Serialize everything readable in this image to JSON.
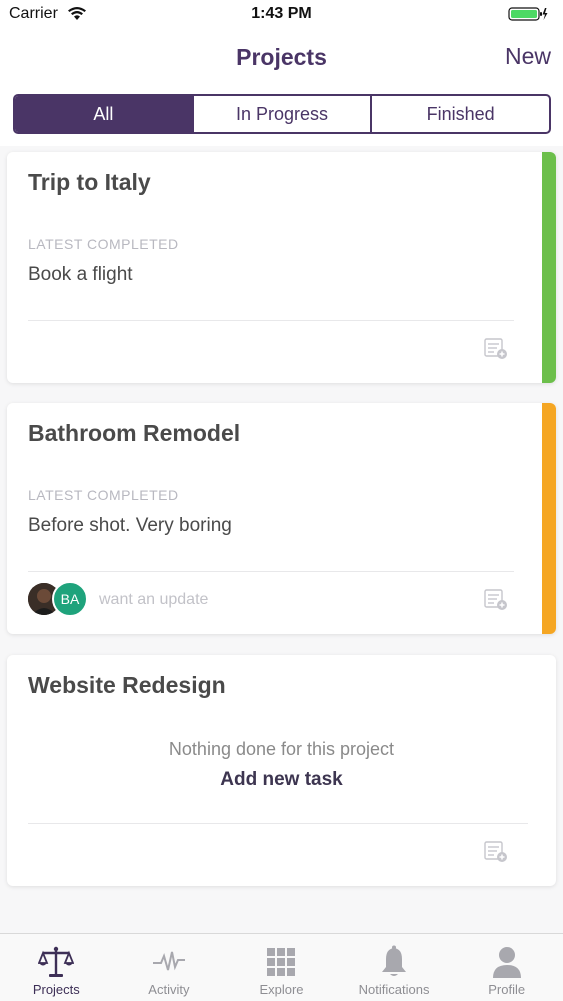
{
  "status_bar": {
    "carrier": "Carrier",
    "time": "1:43 PM"
  },
  "nav": {
    "title": "Projects",
    "new_label": "New"
  },
  "segments": [
    {
      "label": "All",
      "active": true
    },
    {
      "label": "In Progress",
      "active": false
    },
    {
      "label": "Finished",
      "active": false
    }
  ],
  "projects": [
    {
      "title": "Trip to Italy",
      "latest_label": "LATEST COMPLETED",
      "latest_value": "Book a flight",
      "stripe_color": "#6cbf4b"
    },
    {
      "title": "Bathroom Remodel",
      "latest_label": "LATEST COMPLETED",
      "latest_value": "Before shot. Very boring",
      "stripe_color": "#f5a623",
      "avatar_initials": "BA",
      "update_text": "want an update"
    },
    {
      "title": "Website Redesign",
      "empty_text": "Nothing done for this project",
      "add_task_label": "Add new task"
    }
  ],
  "tabs": [
    {
      "label": "Projects",
      "icon": "scales-icon",
      "active": true
    },
    {
      "label": "Activity",
      "icon": "pulse-icon",
      "active": false
    },
    {
      "label": "Explore",
      "icon": "grid-icon",
      "active": false
    },
    {
      "label": "Notifications",
      "icon": "bell-icon",
      "active": false
    },
    {
      "label": "Profile",
      "icon": "person-icon",
      "active": false
    }
  ],
  "colors": {
    "brand": "#4a3566",
    "green": "#6cbf4b",
    "orange": "#f5a623",
    "avatar_teal": "#1fa37c"
  }
}
